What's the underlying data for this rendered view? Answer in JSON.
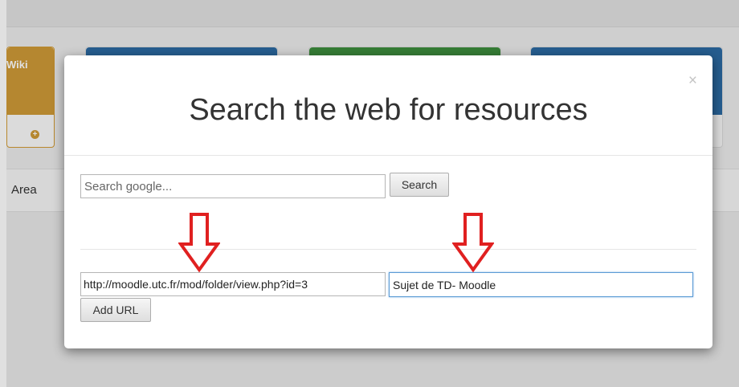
{
  "background": {
    "wiki_card_label": "Wiki",
    "area_label": "Area",
    "colors": {
      "wiki": "#cf9a37",
      "blue": "#2c6aa3",
      "green": "#3e8f3e"
    }
  },
  "modal": {
    "close_label": "×",
    "title": "Search the web for resources",
    "search": {
      "placeholder": "Search google...",
      "button_label": "Search"
    },
    "url_field": {
      "value": "http://moodle.utc.fr/mod/folder/view.php?id=3"
    },
    "title_field": {
      "value": "Sujet de TD- Moodle"
    },
    "add_url_label": "Add URL"
  },
  "annotations": {
    "arrow_color": "#e02020",
    "arrow_icon": "arrow-down-outline-icon"
  }
}
